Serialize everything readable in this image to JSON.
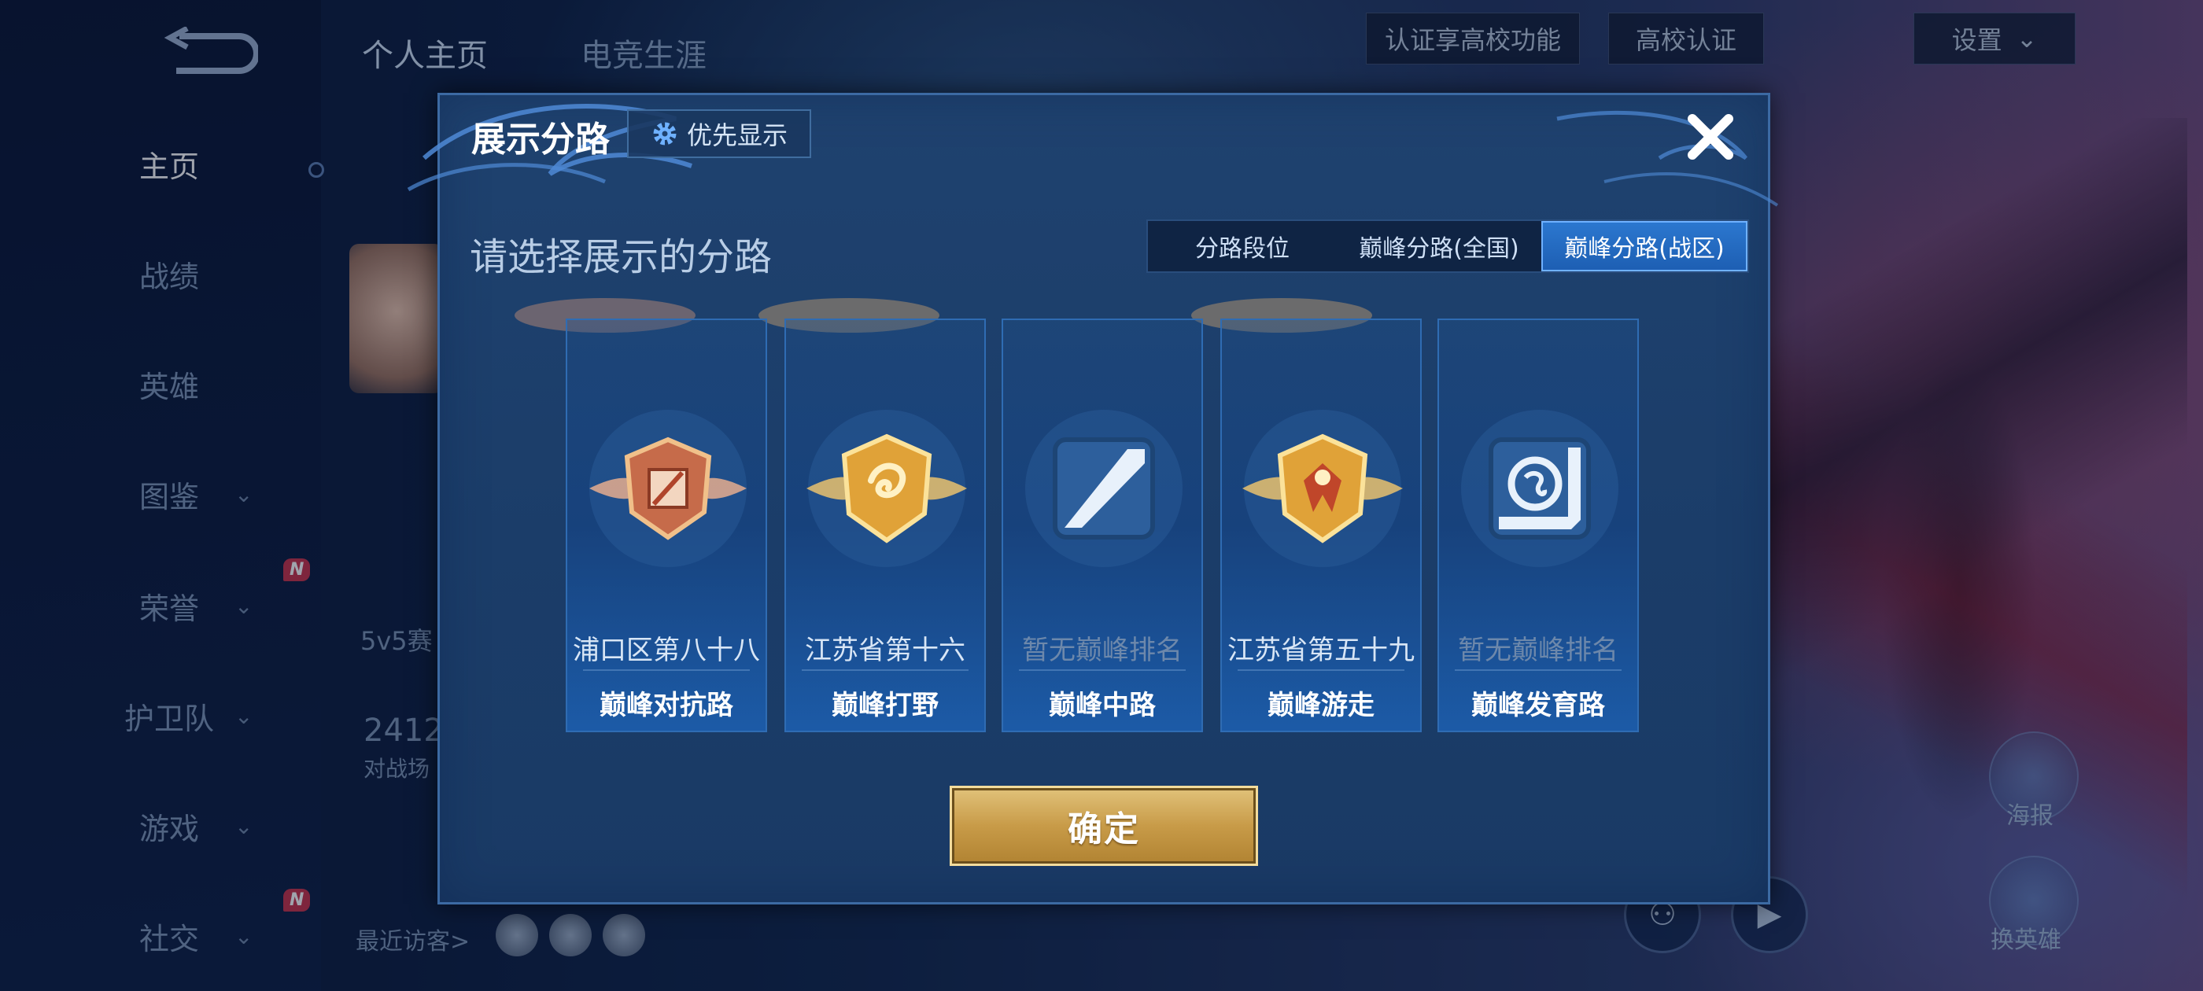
{
  "sidebar": {
    "items": [
      {
        "label": "主页",
        "active": true
      },
      {
        "label": "战绩"
      },
      {
        "label": "英雄"
      },
      {
        "label": "图鉴",
        "chevron": true
      },
      {
        "label": "荣誉",
        "chevron": true,
        "badge": "new"
      },
      {
        "label": "护卫队",
        "chevron": true
      },
      {
        "label": "游戏",
        "chevron": true
      },
      {
        "label": "社交",
        "chevron": true,
        "badge": "new"
      }
    ]
  },
  "page": {
    "tabs": [
      "个人主页",
      "电竞生涯"
    ],
    "cert_hint": "认证享高校功能",
    "cert_button": "高校认证",
    "settings": "设置",
    "mode_label": "5v5赛",
    "count": "2412",
    "count_label": "对战场",
    "visitors_label": "最近访客>",
    "poster_label": "海报",
    "swap_hero_label": "换英雄"
  },
  "modal": {
    "title": "展示分路",
    "priority_button": "优先显示",
    "subtitle": "请选择展示的分路",
    "segments": [
      {
        "label": "分路段位",
        "active": false
      },
      {
        "label": "巅峰分路(全国)",
        "active": false
      },
      {
        "label": "巅峰分路(战区)",
        "active": true
      }
    ],
    "lanes": [
      {
        "rank": "浦口区第八十八",
        "lane": "巅峰对抗路",
        "has_rank": true,
        "emblem": "clash-lane-emblem"
      },
      {
        "rank": "江苏省第十六",
        "lane": "巅峰打野",
        "has_rank": true,
        "emblem": "jungle-emblem"
      },
      {
        "rank": "暂无巅峰排名",
        "lane": "巅峰中路",
        "has_rank": false,
        "emblem": "mid-lane-emblem"
      },
      {
        "rank": "江苏省第五十九",
        "lane": "巅峰游走",
        "has_rank": true,
        "emblem": "roam-emblem"
      },
      {
        "rank": "暂无巅峰排名",
        "lane": "巅峰发育路",
        "has_rank": false,
        "emblem": "farm-lane-emblem"
      }
    ],
    "confirm": "确定"
  },
  "colors": {
    "modal_bg": "#1f426f",
    "accent_blue": "#2c78d0",
    "confirm_gold": "#c89b48",
    "badge_red": "#c8324b"
  }
}
